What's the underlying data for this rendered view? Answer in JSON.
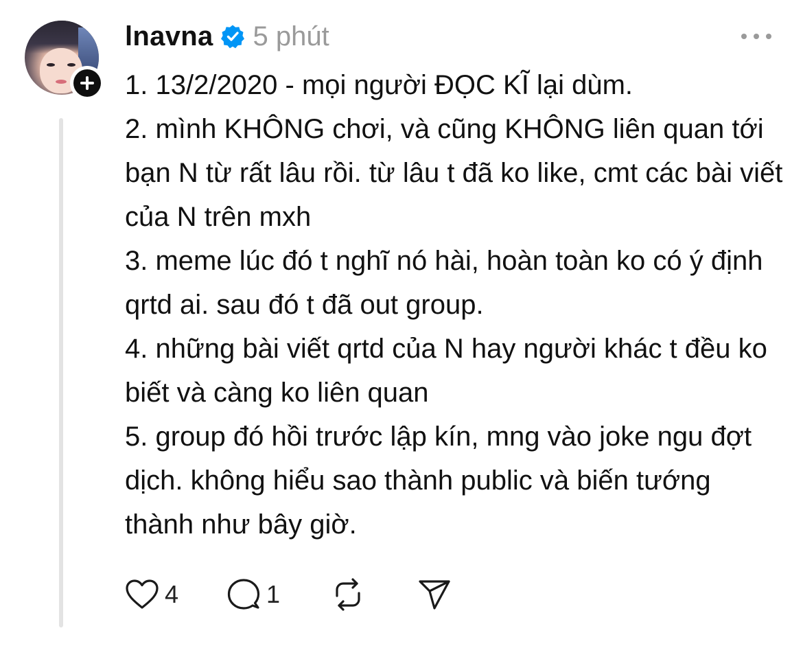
{
  "post": {
    "username": "lnavna",
    "time": "5 phút",
    "paragraphs": [
      "1. 13/2/2020 - mọi người ĐỌC KĨ lại dùm.",
      "2. mình KHÔNG chơi, và cũng KHÔNG liên quan tới bạn N từ rất lâu rồi. từ lâu t đã ko like, cmt các bài viết của N trên mxh",
      "3. meme lúc đó t nghĩ nó hài, hoàn toàn ko có ý định qrtd ai. sau đó t đã out group.",
      "4. những bài viết qrtd của N hay người khác t đều ko biết và càng ko liên quan",
      "5. group đó hồi trước lập kín, mng vào joke ngu đợt dịch. không hiểu sao thành public và biến tướng thành như bây giờ."
    ],
    "like_count": "4",
    "reply_count": "1"
  },
  "colors": {
    "verified": "#0095f6",
    "text": "#111111",
    "muted": "#9a9a9a",
    "thread_line": "#e3e3e3"
  },
  "icons": [
    "verified-badge-icon",
    "plus-icon",
    "more-icon",
    "heart-icon",
    "comment-icon",
    "repost-icon",
    "share-icon"
  ]
}
